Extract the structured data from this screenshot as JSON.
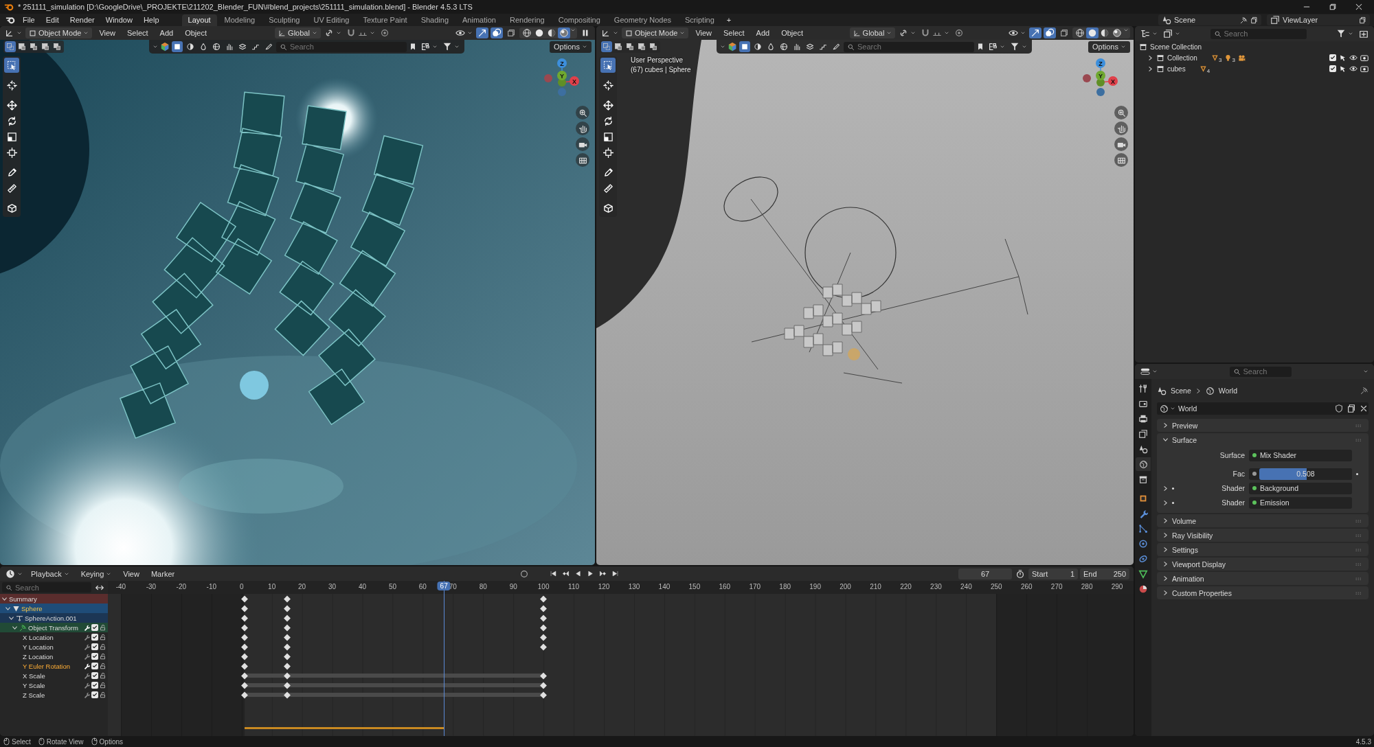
{
  "title_bar": {
    "title": "* 251111_simulation [D:\\GoogleDrive\\_PROJEKTE\\211202_Blender_FUN\\#blend_projects\\251111_simulation.blend] - Blender 4.5.3 LTS"
  },
  "top_bar": {
    "menus": [
      "File",
      "Edit",
      "Render",
      "Window",
      "Help"
    ],
    "workspaces": [
      {
        "label": "Layout",
        "selected": true
      },
      {
        "label": "Modeling",
        "selected": false
      },
      {
        "label": "Sculpting",
        "selected": false
      },
      {
        "label": "UV Editing",
        "selected": false
      },
      {
        "label": "Texture Paint",
        "selected": false
      },
      {
        "label": "Shading",
        "selected": false
      },
      {
        "label": "Animation",
        "selected": false
      },
      {
        "label": "Rendering",
        "selected": false
      },
      {
        "label": "Compositing",
        "selected": false
      },
      {
        "label": "Geometry Nodes",
        "selected": false
      },
      {
        "label": "Scripting",
        "selected": false
      }
    ],
    "add_workspace": "+",
    "scene": "Scene",
    "view_layer": "ViewLayer"
  },
  "viewports": [
    {
      "kind": "rendered",
      "mode": "Object Mode",
      "menus": [
        "View",
        "Select",
        "Add",
        "Object"
      ],
      "orientation": "Global",
      "search_placeholder": "Search",
      "options": "Options",
      "shading": [
        {
          "kind": "wireframe",
          "selected": false
        },
        {
          "kind": "solid",
          "selected": false
        },
        {
          "kind": "material",
          "selected": false
        },
        {
          "kind": "rendered",
          "selected": true
        }
      ],
      "tools": [
        {
          "kind": "select",
          "selected": true
        },
        {
          "kind": "cursor",
          "selected": false
        },
        {
          "kind": "move",
          "selected": false
        },
        {
          "kind": "rotate",
          "selected": false
        },
        {
          "kind": "scale",
          "selected": false
        },
        {
          "kind": "transform",
          "selected": false
        },
        {
          "kind": "annotate",
          "selected": false
        },
        {
          "kind": "measure",
          "selected": false
        },
        {
          "kind": "add_cube",
          "selected": false
        }
      ],
      "gizmo_axes": [
        "Z",
        "Y",
        "X"
      ]
    },
    {
      "kind": "solid",
      "mode": "Object Mode",
      "menus": [
        "View",
        "Select",
        "Add",
        "Object"
      ],
      "orientation": "Global",
      "search_placeholder": "Search",
      "options": "Options",
      "shading": [
        {
          "kind": "wireframe",
          "selected": false
        },
        {
          "kind": "solid",
          "selected": true
        },
        {
          "kind": "material",
          "selected": false
        },
        {
          "kind": "rendered",
          "selected": false
        }
      ],
      "tools": [
        {
          "kind": "select",
          "selected": true
        },
        {
          "kind": "cursor",
          "selected": false
        },
        {
          "kind": "move",
          "selected": false
        },
        {
          "kind": "rotate",
          "selected": false
        },
        {
          "kind": "scale",
          "selected": false
        },
        {
          "kind": "transform",
          "selected": false
        },
        {
          "kind": "annotate",
          "selected": false
        },
        {
          "kind": "measure",
          "selected": false
        },
        {
          "kind": "add_cube",
          "selected": false
        }
      ],
      "gizmo_axes": [
        "Z",
        "Y",
        "X"
      ],
      "overlay_text": [
        "User Perspective",
        "(67) cubes | Sphere"
      ]
    }
  ],
  "outliner": {
    "search_placeholder": "Search",
    "tree": [
      {
        "label": "Scene Collection",
        "children": [
          {
            "label": "Collection",
            "expanded": false,
            "checked": true,
            "counts": [
              {
                "kind": "mesh",
                "text": "3"
              },
              {
                "kind": "light",
                "text": "3"
              },
              {
                "kind": "camera"
              }
            ]
          },
          {
            "label": "cubes",
            "expanded": false,
            "checked": true,
            "counts": [
              {
                "kind": "mesh",
                "text": "4"
              }
            ]
          }
        ]
      }
    ]
  },
  "properties": {
    "search_placeholder": "Search",
    "tabs": [
      {
        "kind": "tool",
        "selected": false
      },
      {
        "kind": "render",
        "selected": false
      },
      {
        "kind": "output",
        "selected": false
      },
      {
        "kind": "view_layer",
        "selected": false
      },
      {
        "kind": "scene",
        "selected": false
      },
      {
        "kind": "world",
        "selected": true
      },
      {
        "kind": "collection",
        "selected": false
      },
      {
        "kind": "object",
        "selected": false
      },
      {
        "kind": "modifiers",
        "selected": false
      },
      {
        "kind": "particles",
        "selected": false
      },
      {
        "kind": "physics",
        "selected": false
      },
      {
        "kind": "constraints",
        "selected": false
      },
      {
        "kind": "data",
        "selected": false
      },
      {
        "kind": "material",
        "selected": false
      }
    ],
    "breadcrumb": [
      "Scene",
      "World"
    ],
    "world_name": "World",
    "panels": [
      {
        "label": "Preview",
        "expanded": false
      },
      {
        "label": "Surface",
        "expanded": true,
        "rows": [
          {
            "kind": "link",
            "label": "Surface",
            "value": "Mix Shader"
          },
          {
            "kind": "slider",
            "label": "Fac",
            "value": "0.508",
            "level": 0.508
          },
          {
            "kind": "link",
            "label": "Shader",
            "value": "Background",
            "expanded": false
          },
          {
            "kind": "link",
            "label": "Shader",
            "value": "Emission",
            "expanded": false
          }
        ]
      },
      {
        "label": "Volume",
        "expanded": false
      },
      {
        "label": "Ray Visibility",
        "expanded": false
      },
      {
        "label": "Settings",
        "expanded": false
      },
      {
        "label": "Viewport Display",
        "expanded": false
      },
      {
        "label": "Animation",
        "expanded": false
      },
      {
        "label": "Custom Properties",
        "expanded": false
      }
    ]
  },
  "timeline": {
    "menus": [
      {
        "label": "Playback",
        "dropdown": true
      },
      {
        "label": "Keying",
        "dropdown": true
      },
      {
        "label": "View",
        "dropdown": false
      },
      {
        "label": "Marker",
        "dropdown": false
      }
    ],
    "current_frame": "67",
    "playhead_frame": "67",
    "start_label": "Start",
    "start": "1",
    "end_label": "End",
    "end": "250",
    "search_placeholder": "Search",
    "ruler": [
      "-40",
      "-30",
      "-20",
      "-10",
      "0",
      "10",
      "20",
      "30",
      "40",
      "50",
      "60",
      "70",
      "80",
      "90",
      "100",
      "110",
      "120",
      "130",
      "140",
      "150",
      "160",
      "170",
      "180",
      "190",
      "200",
      "210",
      "220",
      "230",
      "240",
      "250",
      "260",
      "270",
      "280",
      "290"
    ],
    "channels": [
      {
        "label": "Summary",
        "kind": "summary",
        "expanded": true,
        "keys": [
          {
            "level": 0.1242
          },
          {
            "level": 0.1667
          },
          {
            "level": 0.4242
          }
        ],
        "children": [
          {
            "label": "Sphere",
            "kind": "object",
            "expanded": true,
            "selected": true,
            "keys": [
              {
                "level": 0.1242
              },
              {
                "level": 0.1667
              },
              {
                "level": 0.4242
              }
            ],
            "children": [
              {
                "label": "SphereAction.001",
                "kind": "action",
                "expanded": true,
                "keys": [
                  {
                    "level": 0.1242
                  },
                  {
                    "level": 0.1667
                  },
                  {
                    "level": 0.4242
                  }
                ],
                "children": [
                  {
                    "label": "Object Transform",
                    "kind": "group",
                    "expanded": true,
                    "checked": true,
                    "keys": [
                      {
                        "level": 0.1242
                      },
                      {
                        "level": 0.1667
                      },
                      {
                        "level": 0.4242
                      }
                    ],
                    "children": [
                      {
                        "label": "X Location",
                        "kind": "fcurve",
                        "selected": false,
                        "checked": true,
                        "hold": false,
                        "keys": [
                          {
                            "level": 0.1242
                          },
                          {
                            "level": 0.1667
                          },
                          {
                            "level": 0.4242
                          }
                        ]
                      },
                      {
                        "label": "Y Location",
                        "kind": "fcurve",
                        "selected": false,
                        "checked": true,
                        "hold": false,
                        "keys": [
                          {
                            "level": 0.1242
                          },
                          {
                            "level": 0.1667
                          },
                          {
                            "level": 0.4242
                          }
                        ]
                      },
                      {
                        "label": "Z Location",
                        "kind": "fcurve",
                        "selected": false,
                        "checked": true,
                        "hold": false,
                        "keys": [
                          {
                            "level": 0.1242
                          },
                          {
                            "level": 0.1667
                          }
                        ]
                      },
                      {
                        "label": "Y Euler Rotation",
                        "kind": "fcurve",
                        "selected": true,
                        "checked": true,
                        "hold": false,
                        "keys": [
                          {
                            "level": 0.1242
                          },
                          {
                            "level": 0.1667
                          }
                        ]
                      },
                      {
                        "label": "X Scale",
                        "kind": "fcurve",
                        "selected": false,
                        "checked": true,
                        "hold": true,
                        "keys": [
                          {
                            "level": 0.1242
                          },
                          {
                            "level": 0.1667
                          },
                          {
                            "level": 0.4242
                          }
                        ]
                      },
                      {
                        "label": "Y Scale",
                        "kind": "fcurve",
                        "selected": false,
                        "checked": true,
                        "hold": true,
                        "keys": [
                          {
                            "level": 0.1242
                          },
                          {
                            "level": 0.1667
                          },
                          {
                            "level": 0.4242
                          }
                        ]
                      },
                      {
                        "label": "Z Scale",
                        "kind": "fcurve",
                        "selected": false,
                        "checked": true,
                        "hold": true,
                        "keys": [
                          {
                            "level": 0.1242
                          },
                          {
                            "level": 0.1667
                          },
                          {
                            "level": 0.4242
                          }
                        ]
                      }
                    ]
                  }
                ]
              }
            ]
          }
        ]
      }
    ]
  },
  "status_bar": {
    "items": [
      {
        "kind": "left_mouse",
        "label": "Select"
      },
      {
        "kind": "middle_mouse",
        "label": "Rotate View"
      },
      {
        "kind": "right_mouse",
        "label": "Options"
      }
    ],
    "version": "4.5.3"
  }
}
